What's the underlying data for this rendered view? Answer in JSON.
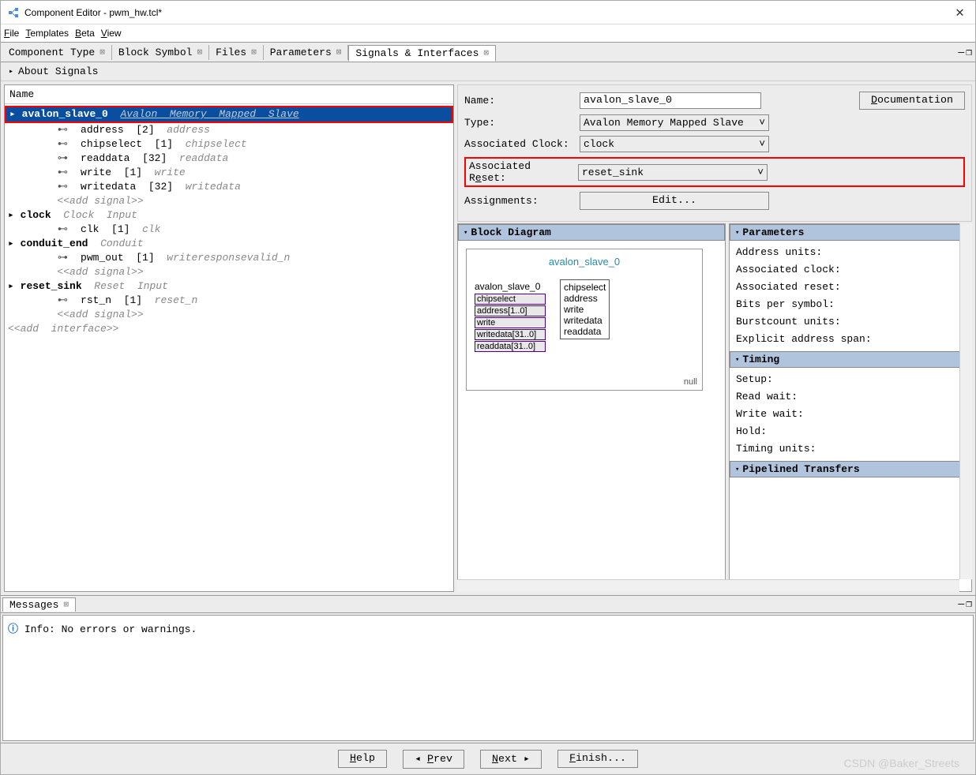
{
  "window": {
    "title": "Component Editor - pwm_hw.tcl*"
  },
  "menu": {
    "file": "File",
    "templates": "Templates",
    "beta": "Beta",
    "view": "View"
  },
  "tabs": [
    {
      "label": "Component Type"
    },
    {
      "label": "Block Symbol"
    },
    {
      "label": "Files"
    },
    {
      "label": "Parameters"
    },
    {
      "label": "Signals & Interfaces",
      "active": true
    }
  ],
  "about": "About Signals",
  "tree": {
    "header": "Name",
    "avalon": {
      "name": "avalon_slave_0",
      "desc": "Avalon  Memory  Mapped  Slave",
      "signals": [
        {
          "name": "address",
          "w": "[2]",
          "role": "address"
        },
        {
          "name": "chipselect",
          "w": "[1]",
          "role": "chipselect"
        },
        {
          "name": "readdata",
          "w": "[32]",
          "role": "readdata"
        },
        {
          "name": "write",
          "w": "[1]",
          "role": "write"
        },
        {
          "name": "writedata",
          "w": "[32]",
          "role": "writedata"
        }
      ],
      "add": "<<add signal>>"
    },
    "clock": {
      "name": "clock",
      "desc": "Clock  Input",
      "sig": {
        "name": "clk",
        "w": "[1]",
        "role": "clk"
      }
    },
    "conduit": {
      "name": "conduit_end",
      "desc": "Conduit",
      "sig": {
        "name": "pwm_out",
        "w": "[1]",
        "role": "writeresponsevalid_n"
      },
      "add": "<<add signal>>"
    },
    "reset": {
      "name": "reset_sink",
      "desc": "Reset  Input",
      "sig": {
        "name": "rst_n",
        "w": "[1]",
        "role": "reset_n"
      },
      "add": "<<add signal>>"
    },
    "addif": "<<add  interface>>"
  },
  "form": {
    "name_l": "Name:",
    "name_v": "avalon_slave_0",
    "type_l": "Type:",
    "type_v": "Avalon Memory Mapped Slave",
    "clk_l": "Associated Clock:",
    "clk_v": "clock",
    "rst_l": "Associated Reset:",
    "rst_v": "reset_sink",
    "asg_l": "Assignments:",
    "edit": "Edit...",
    "doc": "Documentation"
  },
  "block": {
    "hdr": "Block Diagram",
    "title": "avalon_slave_0",
    "inner_title": "avalon_slave_0",
    "ports": [
      "chipselect",
      "address[1..0]",
      "write",
      "writedata[31..0]",
      "readdata[31..0]"
    ],
    "inner_ports": [
      "chipselect",
      "address",
      "write",
      "writedata",
      "readdata"
    ],
    "null": "null"
  },
  "params": {
    "hdr": "Parameters",
    "p1": "Address units:",
    "p2": "Associated clock:",
    "p3": "Associated reset:",
    "p4": "Bits per symbol:",
    "p5": "Burstcount units:",
    "p6": "Explicit address span:",
    "timing_hdr": "Timing",
    "t1": "Setup:",
    "t2": "Read wait:",
    "t3": "Write wait:",
    "t4": "Hold:",
    "t5": "Timing units:",
    "pipe_hdr": "Pipelined Transfers"
  },
  "messages": {
    "tab": "Messages",
    "info": "Info: No errors or warnings."
  },
  "footer": {
    "help": "Help",
    "prev": "Prev",
    "next": "Next",
    "finish": "Finish..."
  },
  "watermark": "CSDN @Baker_Streets"
}
